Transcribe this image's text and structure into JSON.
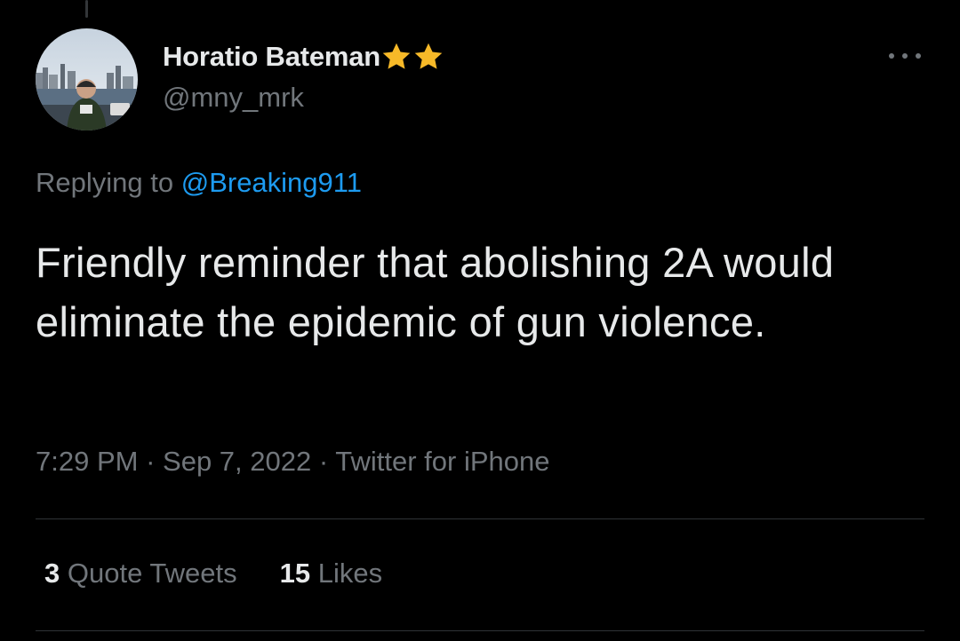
{
  "tweet": {
    "author": {
      "display_name": "Horatio Bateman",
      "handle": "@mny_mrk",
      "badge_icons": [
        "star-icon",
        "star-icon"
      ],
      "badge_color": "#f7b928"
    },
    "reply": {
      "prefix": "Replying to",
      "mention": "@Breaking911"
    },
    "text": "Friendly reminder that abolishing 2A would eliminate the epidemic of gun violence.",
    "meta": {
      "time": "7:29 PM",
      "separator": "·",
      "date": "Sep 7, 2022",
      "source": "Twitter for iPhone"
    },
    "stats": {
      "quote_tweets_count": "3",
      "quote_tweets_label": "Quote Tweets",
      "likes_count": "15",
      "likes_label": "Likes"
    },
    "more_icon": "more-horizontal-icon"
  },
  "colors": {
    "background": "#000000",
    "primary_text": "#e7e9ea",
    "secondary_text": "#71767b",
    "link": "#1d9bf0",
    "divider": "#2f3336"
  }
}
